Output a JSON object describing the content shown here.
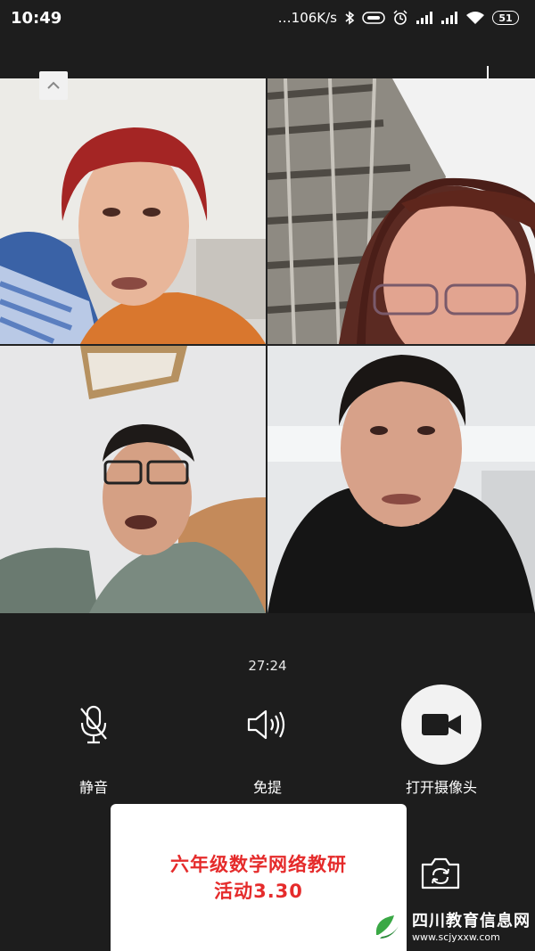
{
  "status_bar": {
    "time": "10:49",
    "network_speed": "…106K/s",
    "battery": "51",
    "icons": [
      "bluetooth-icon",
      "vibrate-icon",
      "alarm-icon",
      "signal-icon",
      "signal-icon",
      "wifi-icon",
      "battery-icon"
    ]
  },
  "video_grid": {
    "participants": [
      {
        "tile": "top-left",
        "desc_color": "#c14a2a"
      },
      {
        "tile": "top-right",
        "desc_color": "#6b4a3a"
      },
      {
        "tile": "bottom-left",
        "desc_color": "#5e6b60"
      },
      {
        "tile": "bottom-right",
        "desc_color": "#1a1a1a"
      }
    ]
  },
  "call": {
    "duration": "27:24",
    "controls": {
      "mute_label": "静音",
      "speaker_label": "免提",
      "camera_label": "打开摄像头"
    }
  },
  "overlay": {
    "line1": "六年级数学网络教研",
    "line2": "活动3.30"
  },
  "watermark": {
    "name": "四川教育信息网",
    "url": "www.scjyxxw.com"
  },
  "colors": {
    "background": "#1d1d1d",
    "overlay_text": "#e52b2b",
    "camera_button": "#f2f2f2"
  }
}
